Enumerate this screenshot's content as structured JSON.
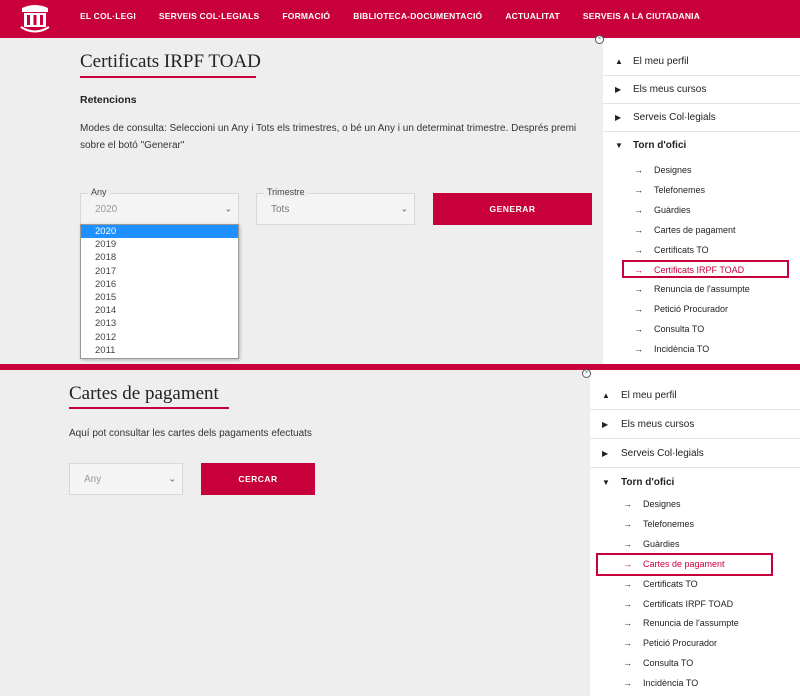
{
  "topnav": {
    "logo_icon": "coat-of-arms-logo",
    "items": [
      "EL COL·LEGI",
      "SERVEIS COL·LEGIALS",
      "FORMACIÓ",
      "BIBLIOTECA-DOCUMENTACIÓ",
      "ACTUALITAT",
      "SERVEIS A LA CIUTADANIA"
    ]
  },
  "panel1": {
    "title": "Certificats IRPF TOAD",
    "subtitle": "Retencions",
    "description": "Modes de consulta: Seleccioni un Any i Tots els trimestres, o bé un Any i un determinat trimestre. Després premi sobre el botó \"Generar\"",
    "year_label": "Any",
    "year_value": "2020",
    "quarter_label": "Trimestre",
    "quarter_value": "Tots",
    "generate_label": "GENERAR",
    "year_options": [
      "2020",
      "2019",
      "2018",
      "2017",
      "2016",
      "2015",
      "2014",
      "2013",
      "2012",
      "2011"
    ],
    "selected_option_index": 0
  },
  "sidebar1": {
    "sections": [
      "El meu perfil",
      "Els meus cursos",
      "Serveis Col·legials",
      "Torn d'ofici"
    ],
    "section_arrows": [
      "▲",
      "▶",
      "▶",
      "▼"
    ],
    "sub_items": [
      "Designes",
      "Telefonemes",
      "Guàrdies",
      "Cartes de pagament",
      "Certificats TO",
      "Certificats IRPF TOAD",
      "Renuncia de l'assumpte",
      "Petició Procurador",
      "Consulta TO",
      "Incidència TO"
    ],
    "active_index": 5
  },
  "panel2": {
    "title": "Cartes de pagament",
    "description": "Aquí pot consultar les cartes dels pagaments efectuats",
    "year_placeholder": "Any",
    "search_label": "CERCAR"
  },
  "sidebar2": {
    "sections": [
      "El meu perfil",
      "Els meus cursos",
      "Serveis Col·legials",
      "Torn d'ofici"
    ],
    "section_arrows": [
      "▲",
      "▶",
      "▶",
      "▼"
    ],
    "sub_items": [
      "Designes",
      "Telefonemes",
      "Guàrdies",
      "Cartes de pagament",
      "Certificats TO",
      "Certificats IRPF TOAD",
      "Renuncia de l'assumpte",
      "Petició Procurador",
      "Consulta TO",
      "Incidència TO"
    ],
    "active_index": 3
  },
  "colors": {
    "accent": "#c8003c",
    "selected_option": "#1e90ff"
  },
  "icons": {
    "sub_arrow": "→",
    "chevron": "⌄",
    "close": "×"
  }
}
